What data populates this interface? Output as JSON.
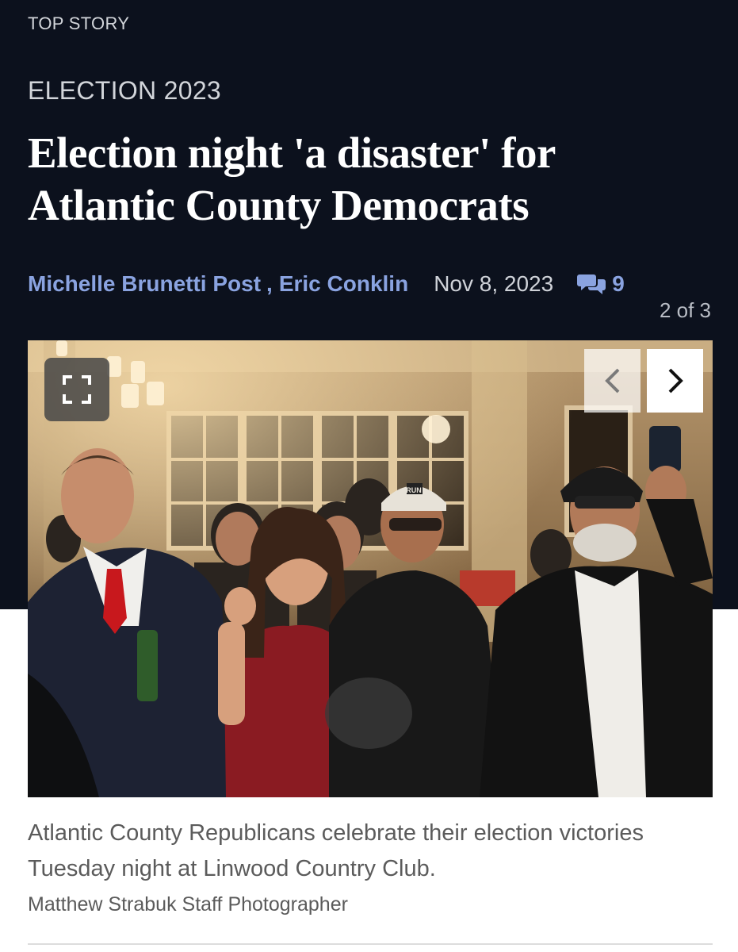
{
  "header": {
    "kicker": "TOP STORY",
    "section": "ELECTION 2023",
    "headline": "Election night 'a disaster' for Atlantic County Democrats"
  },
  "byline": {
    "authors": [
      "Michelle Brunetti Post",
      "Eric Conklin"
    ],
    "separator": ",",
    "date": "Nov 8, 2023",
    "comment_count": "9",
    "comment_icon": "comment-bubbles-icon"
  },
  "gallery": {
    "counter": "2 of 3",
    "expand_icon": "expand-icon",
    "prev_icon": "chevron-left-icon",
    "next_icon": "chevron-right-icon",
    "hat_text": "RUN",
    "caption": "Atlantic County Republicans celebrate their election victories Tuesday night at Linwood Country Club.",
    "credit": "Matthew Strabuk Staff Photographer"
  },
  "colors": {
    "background_dark": "#0c111d",
    "link_blue": "#8aa3e0",
    "caption_gray": "#5b5b5b"
  }
}
